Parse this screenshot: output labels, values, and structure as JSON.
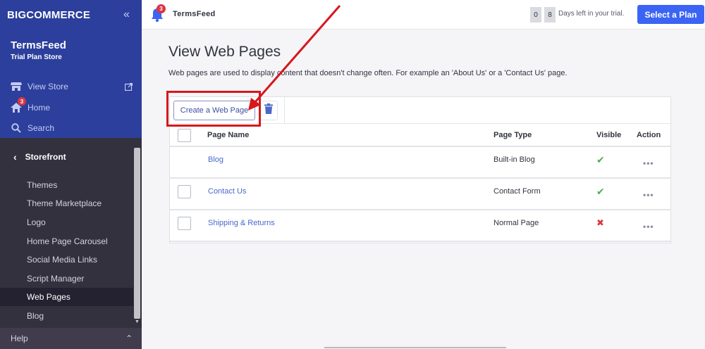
{
  "brand": {
    "logo_text": "BIGCOMMERCE",
    "collapse_label": "«"
  },
  "store": {
    "name": "TermsFeed",
    "plan": "Trial Plan Store"
  },
  "sidebar": {
    "links": [
      {
        "label": "View Store",
        "icon": "store-icon"
      },
      {
        "label": "Home",
        "icon": "home-icon",
        "badge": "3"
      },
      {
        "label": "Search",
        "icon": "search-icon"
      }
    ],
    "section": {
      "label": "Storefront",
      "back_icon": "‹"
    },
    "items": [
      {
        "label": "Themes"
      },
      {
        "label": "Theme Marketplace"
      },
      {
        "label": "Logo"
      },
      {
        "label": "Home Page Carousel"
      },
      {
        "label": "Social Media Links"
      },
      {
        "label": "Script Manager"
      },
      {
        "label": "Web Pages",
        "active": true
      },
      {
        "label": "Blog"
      }
    ],
    "help": {
      "label": "Help",
      "chevron": "⌃"
    }
  },
  "header": {
    "notification_count": "3",
    "store_name": "TermsFeed",
    "trial_digits": [
      "0",
      "8"
    ],
    "trial_text": "Days left in your trial.",
    "select_plan_label": "Select a Plan"
  },
  "main": {
    "title": "View Web Pages",
    "description": "Web pages are used to display content that doesn't change often. For example an 'About Us' or a 'Contact Us' page.",
    "create_button_label": "Create a Web Page",
    "columns": [
      "Page Name",
      "Page Type",
      "Visible",
      "Action"
    ],
    "rows": [
      {
        "name": "Blog",
        "type": "Built-in Blog",
        "visible": "✔",
        "visible_color": "#4caf50",
        "action": "•••",
        "has_checkbox": false
      },
      {
        "name": "Contact Us",
        "type": "Contact Form",
        "visible": "✔",
        "visible_color": "#4caf50",
        "action": "•••",
        "has_checkbox": true
      },
      {
        "name": "Shipping & Returns",
        "type": "Normal Page",
        "visible": "✖",
        "visible_color": "#db3643",
        "action": "•••",
        "has_checkbox": true
      }
    ]
  },
  "colors": {
    "accent": "#3c64f4",
    "sidebar_top": "#2c3f9c",
    "sidebar": "#34313f",
    "annotation": "#d7171c"
  }
}
